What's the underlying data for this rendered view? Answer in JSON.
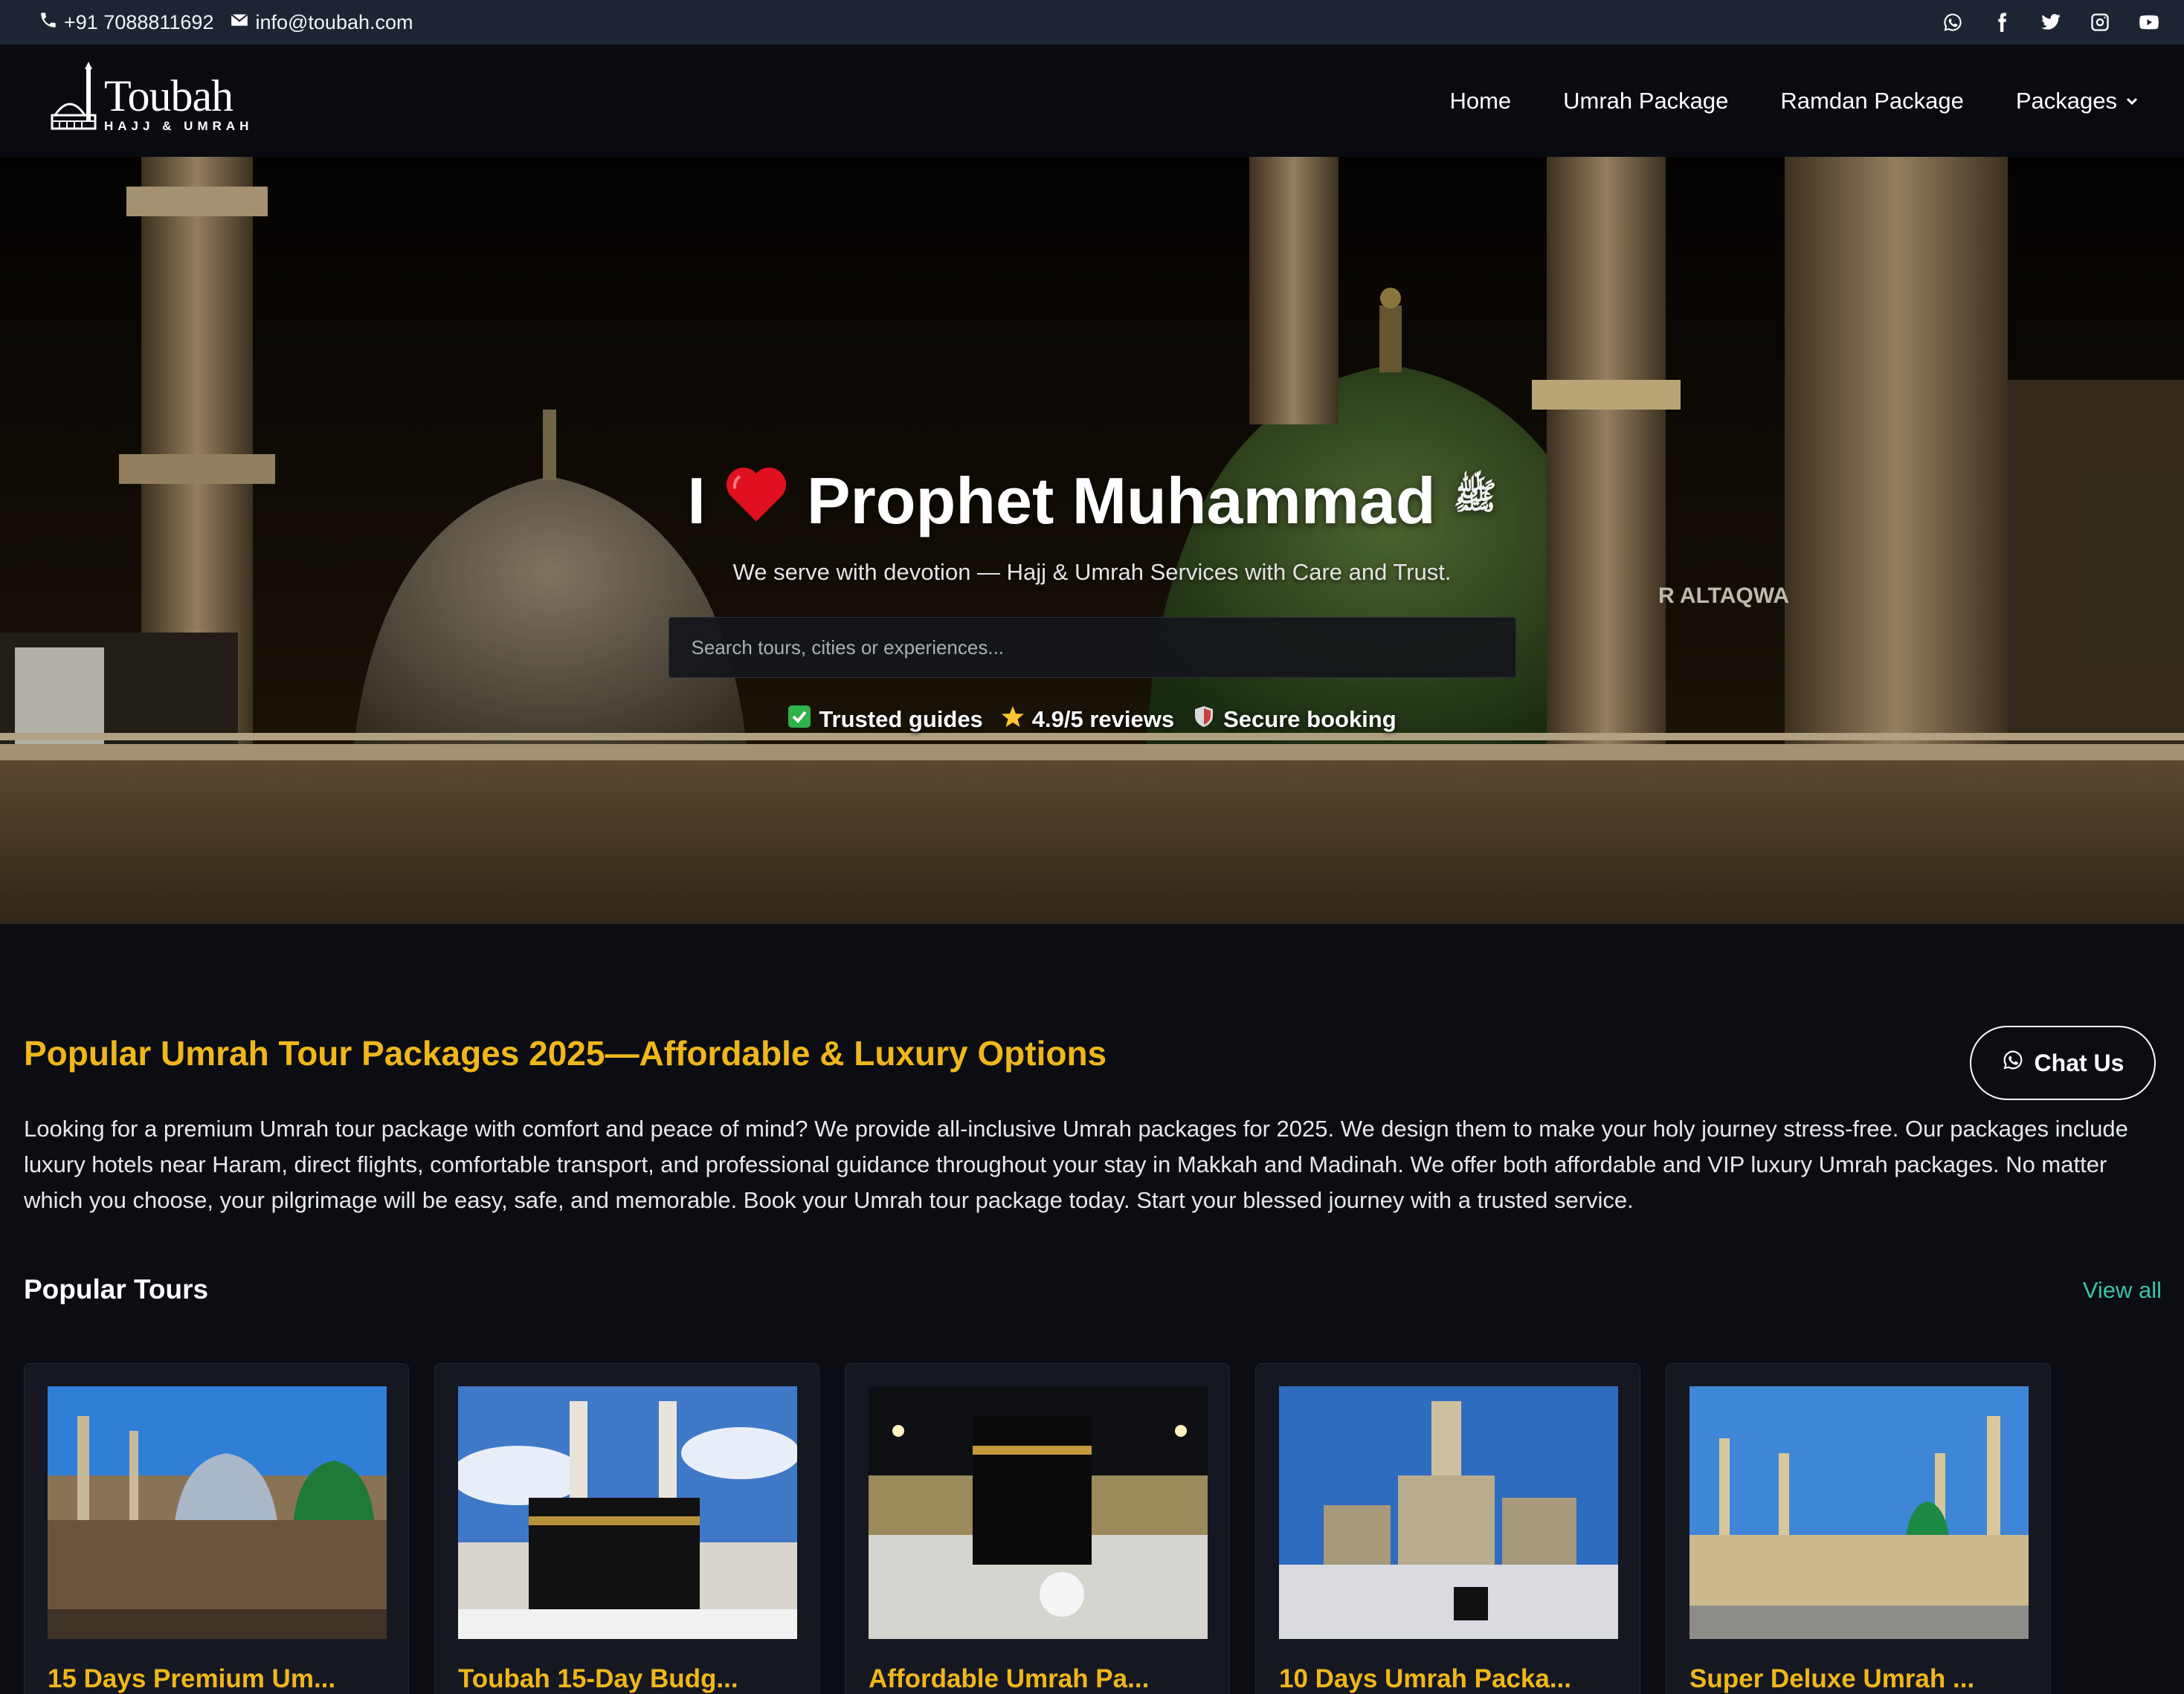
{
  "topbar": {
    "phone": "+91 7088811692",
    "email": "info@toubah.com",
    "social_icons": [
      "whatsapp-icon",
      "facebook-icon",
      "twitter-icon",
      "instagram-icon",
      "youtube-icon"
    ]
  },
  "brand": {
    "name": "Toubah",
    "tagline": "HAJJ & UMRAH"
  },
  "nav": {
    "items": [
      "Home",
      "Umrah Package",
      "Ramdan Package",
      "Packages"
    ]
  },
  "hero": {
    "title_prefix": "I",
    "title_main": "Prophet Muhammad",
    "pbuh": "ﷺ",
    "subtitle": "We serve with devotion — Hajj & Umrah Services with Care and Trust.",
    "search_placeholder": "Search tours, cities or experiences...",
    "trust": [
      "Trusted guides",
      "4.9/5 reviews",
      "Secure booking"
    ]
  },
  "main": {
    "section_title": "Popular Umrah Tour Packages 2025—Affordable & Luxury Options",
    "chat_label": "Chat Us",
    "intro": "Looking for a premium Umrah tour package with comfort and peace of mind? We provide all-inclusive Umrah packages for 2025. We design them to make your holy journey stress-free. Our packages include luxury hotels near Haram, direct flights, comfortable transport, and professional guidance throughout your stay in Makkah and Madinah. We offer both affordable and VIP luxury Umrah packages. No matter which you choose, your pilgrimage will be easy, safe, and memorable. Book your Umrah tour package today. Start your blessed journey with a trusted service.",
    "popular_title": "Popular Tours",
    "view_all": "View all"
  },
  "tours": [
    {
      "title": "15 Days Premium Um..."
    },
    {
      "title": "Toubah 15-Day Budg..."
    },
    {
      "title": "Affordable Umrah Pa..."
    },
    {
      "title": "10 Days Umrah Packa..."
    },
    {
      "title": "Super Deluxe Umrah ..."
    }
  ],
  "colors": {
    "accent": "#f0b71a",
    "link": "#3ec1a9",
    "topbar": "#1d2535",
    "background": "#0b0d12"
  }
}
